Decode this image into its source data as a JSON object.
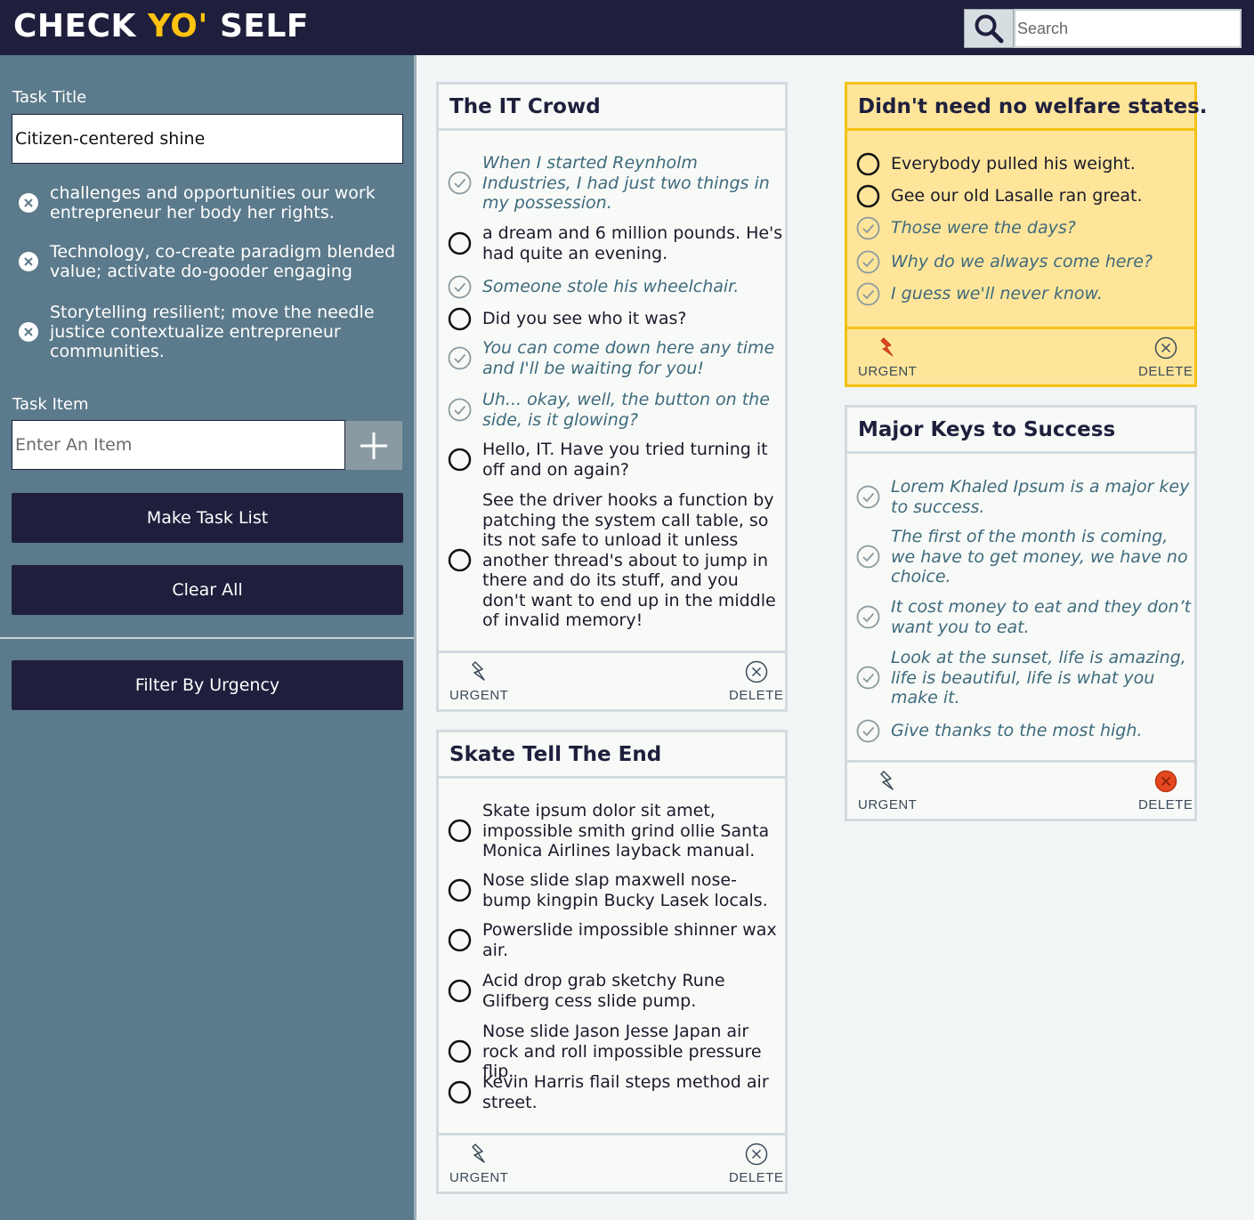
{
  "header": {
    "logo_part1": "CHECK ",
    "logo_part2": "YO'",
    "logo_part3": " SELF",
    "search_placeholder": "Search",
    "search_icon": "magnifier-icon"
  },
  "sidebar": {
    "task_title_label": "Task Title",
    "task_title_value": "Citizen-centered shine",
    "draft_items": [
      "challenges and opportunities our work entrepreneur her body her rights.",
      "Technology, co-create paradigm blended value; activate do-gooder engaging",
      "Storytelling resilient; move the needle justice contextualize entrepreneur communities."
    ],
    "task_item_label": "Task Item",
    "task_item_placeholder": "Enter An Item",
    "make_button": "Make Task List",
    "clear_button": "Clear All",
    "filter_button": "Filter By Urgency"
  },
  "labels": {
    "urgent": "URGENT",
    "delete": "DELETE"
  },
  "colors": {
    "navy": "#1f1f3d",
    "accent_yellow": "#ffc20e",
    "urgent_bg": "#ffe59a",
    "sidebar_bg": "#5b7a8b",
    "delete_active": "#e4471f"
  },
  "cards": [
    {
      "title": "The IT Crowd",
      "urgent": false,
      "delete_active": false,
      "tasks": [
        {
          "text": "When I started Reynholm Industries, I had just two things in my possession.",
          "done": true
        },
        {
          "text": "a dream and 6 million pounds. He's had quite an evening.",
          "done": false
        },
        {
          "text": "Someone stole his wheelchair.",
          "done": true
        },
        {
          "text": "Did you see who it was?",
          "done": false
        },
        {
          "text": "You can come down here any time and I'll be waiting for you!",
          "done": true
        },
        {
          "text": "Uh... okay, well, the button on the side, is it glowing?",
          "done": true
        },
        {
          "text": "Hello, IT. Have you tried turning it off and on again?",
          "done": false
        },
        {
          "text": "See the driver hooks a function by patching the system call table, so its not safe to unload it unless another thread's about to jump in there and do its stuff, and you don't want to end up in the middle of invalid memory!",
          "done": false
        }
      ]
    },
    {
      "title": "Skate Tell The End",
      "urgent": false,
      "delete_active": false,
      "tasks": [
        {
          "text": "Skate ipsum dolor sit amet, impossible smith grind ollie Santa Monica Airlines layback manual.",
          "done": false
        },
        {
          "text": "Nose slide slap maxwell nose-bump kingpin Bucky Lasek locals.",
          "done": false
        },
        {
          "text": "Powerslide impossible shinner wax air.",
          "done": false
        },
        {
          "text": "Acid drop grab sketchy Rune Glifberg cess slide pump.",
          "done": false
        },
        {
          "text": "Nose slide Jason Jesse Japan air rock and roll impossible pressure flip.",
          "done": false
        },
        {
          "text": "Kevin Harris flail steps method air street.",
          "done": false
        }
      ]
    },
    {
      "title": "Didn't need no welfare states.",
      "urgent": true,
      "delete_active": false,
      "tasks": [
        {
          "text": "Everybody pulled his weight.",
          "done": false
        },
        {
          "text": "Gee our old Lasalle ran great.",
          "done": false
        },
        {
          "text": "Those were the days?",
          "done": true
        },
        {
          "text": "Why do we always come here?",
          "done": true
        },
        {
          "text": "I guess we'll never know.",
          "done": true
        }
      ]
    },
    {
      "title": "Major Keys to Success",
      "urgent": false,
      "delete_active": true,
      "tasks": [
        {
          "text": "Lorem Khaled Ipsum is a major key to success.",
          "done": true
        },
        {
          "text": "The first of the month is coming, we have to get money, we have no choice.",
          "done": true
        },
        {
          "text": "It cost money to eat and they don’t want you to eat.",
          "done": true
        },
        {
          "text": "Look at the sunset, life is amazing, life is beautiful, life is what you make it.",
          "done": true
        },
        {
          "text": "Give thanks to the most high.",
          "done": true
        }
      ]
    }
  ]
}
